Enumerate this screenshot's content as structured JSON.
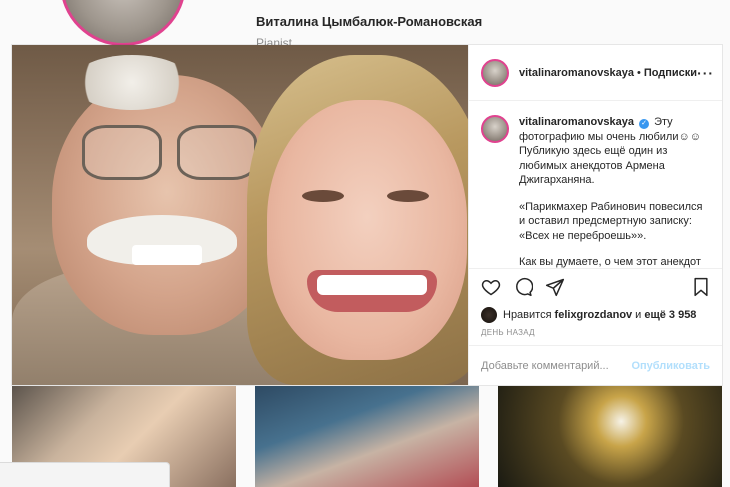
{
  "profile": {
    "name": "Виталина Цымбалюк-Романовская",
    "subtitle": "Pianist"
  },
  "post": {
    "username": "vitalinaromanovskaya",
    "follow_label": "Подписки",
    "dot": "•",
    "more_label": "···",
    "caption": {
      "username": "vitalinaromanovskaya",
      "verified_mark": "✓",
      "line1": "Эту фотографию мы очень любили☺☺ Публикую здесь ещё один из любимых анекдотов Армена Джигарханяна.",
      "line2": "«Парикмахер Рабинович повесился и оставил предсмертную записку: «Всех не переброешь»».",
      "line3": "Как вы думаете, о чем этот анекдот ?"
    },
    "likes": {
      "prefix": "Нравится",
      "user": "felixgrozdanov",
      "middle": "и",
      "count": "ещё 3 958"
    },
    "timestamp": "ДЕНЬ НАЗАД",
    "comment": {
      "placeholder": "Добавьте комментарий...",
      "publish_label": "Опубликовать"
    }
  },
  "icons": [
    "heart-icon",
    "comment-icon",
    "share-icon",
    "bookmark-icon",
    "verified-badge-icon",
    "more-options-icon"
  ],
  "colors": {
    "link_disabled": "#b2dffc",
    "verified": "#3897f0",
    "story_ring": "#e0428f"
  }
}
